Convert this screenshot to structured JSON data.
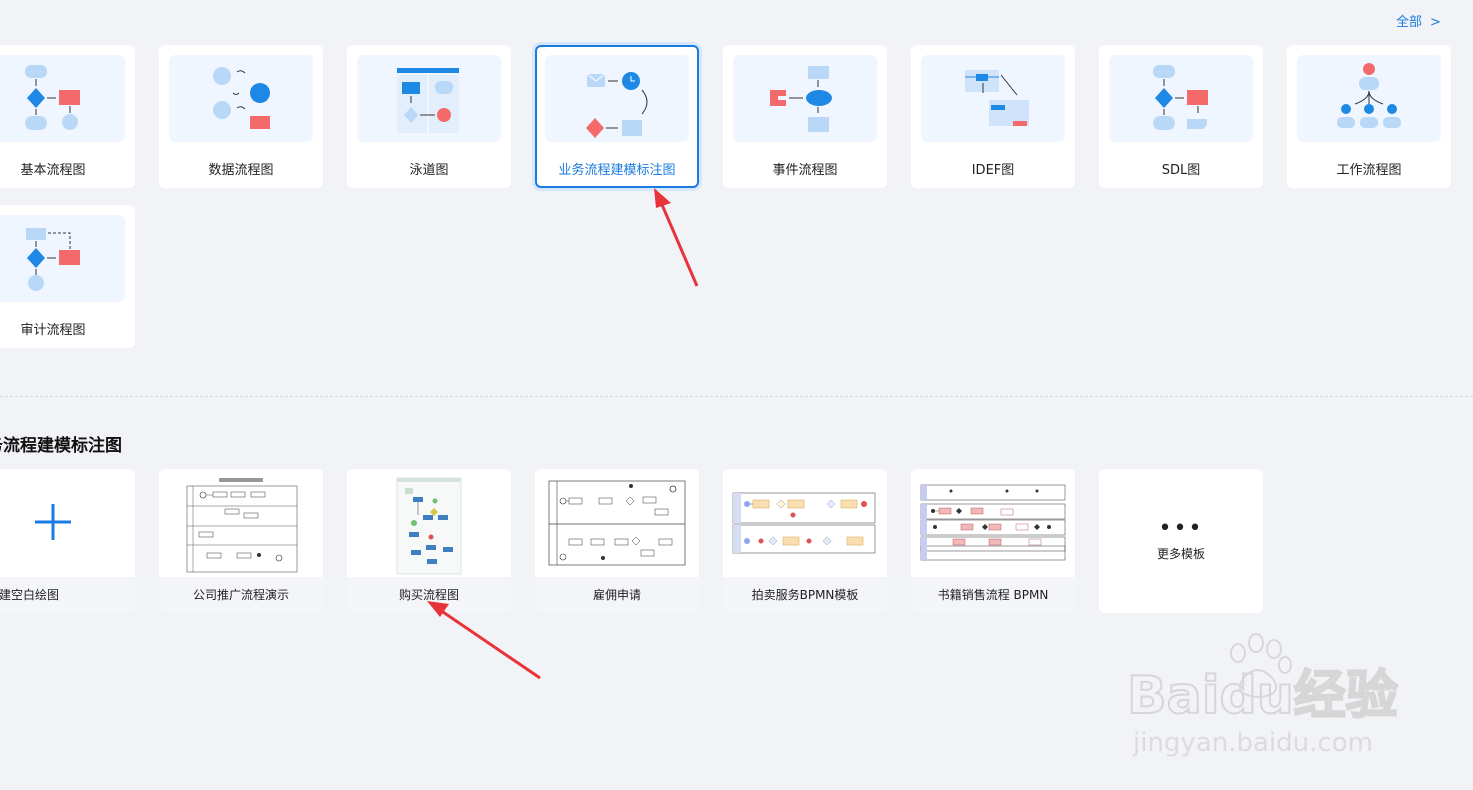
{
  "header": {
    "all_link": "全部",
    "all_chevron": ">"
  },
  "diagram_types": [
    {
      "label": "基本流程图"
    },
    {
      "label": "数据流程图"
    },
    {
      "label": "泳道图"
    },
    {
      "label": "业务流程建模标注图",
      "selected": true
    },
    {
      "label": "事件流程图"
    },
    {
      "label": "IDEF图"
    },
    {
      "label": "SDL图"
    },
    {
      "label": "工作流程图"
    },
    {
      "label": "审计流程图"
    }
  ],
  "section": {
    "title": "务流程建模标注图"
  },
  "templates": [
    {
      "label": "新建空白绘图"
    },
    {
      "label": "公司推广流程演示"
    },
    {
      "label": "购买流程图"
    },
    {
      "label": "雇佣申请"
    },
    {
      "label": "拍卖服务BPMN模板"
    },
    {
      "label": "书籍销售流程 BPMN"
    }
  ],
  "more_templates": {
    "dots": "•••",
    "label": "更多模板"
  },
  "watermark": {
    "brand": "Baidu经验",
    "url": "jingyan.baidu.com"
  },
  "colors": {
    "accent": "#1a7be0",
    "arrow": "#e8333b",
    "light_blue": "#b9d8f7",
    "blue": "#1e88e5",
    "red": "#f46a6a"
  }
}
